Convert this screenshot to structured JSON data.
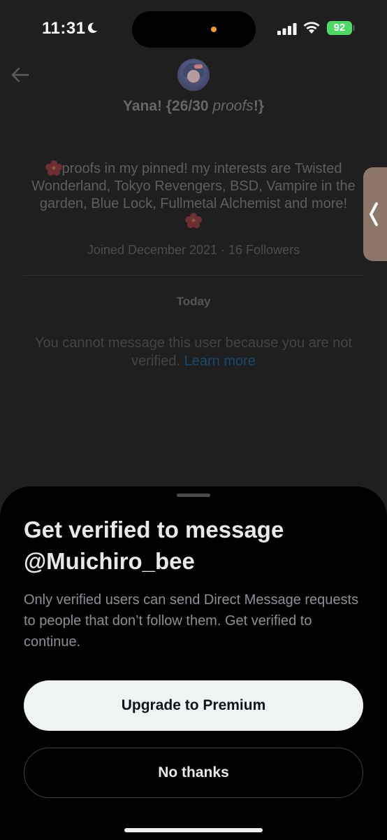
{
  "status_bar": {
    "time": "11:31",
    "battery": "92"
  },
  "icons": {
    "moon": "moon-icon",
    "signal": "signal-icon",
    "wifi": "wifi-icon",
    "back": "back-arrow-icon",
    "flower": "hibiscus-icon",
    "chevron": "chevron-left-icon"
  },
  "colors": {
    "sheet_background": "#000000",
    "primary_button": "#eff3f4",
    "link": "#1d9bf0",
    "battery": "#4cd964"
  },
  "header": {
    "name_prefix": "Yana! {26/30 ",
    "name_italic": "proofs",
    "name_suffix": "!}"
  },
  "profile": {
    "bio": "proofs in my pinned! my interests are Twisted Wonderland, Tokyo Revengers, BSD, Vampire in the garden, Blue Lock, Fullmetal Alchemist and more!",
    "joined": "Joined December 2021 · 16 Followers"
  },
  "conversation": {
    "date_label": "Today",
    "notice": "You cannot message this user because you are not verified.",
    "learn_more": "Learn more"
  },
  "sheet": {
    "title": "Get verified to message @Muichiro_bee",
    "body": "Only verified users can send Direct Message requests to people that don’t follow them.  Get verified to continue.",
    "primary_button": "Upgrade to Premium",
    "secondary_button": "No thanks"
  }
}
